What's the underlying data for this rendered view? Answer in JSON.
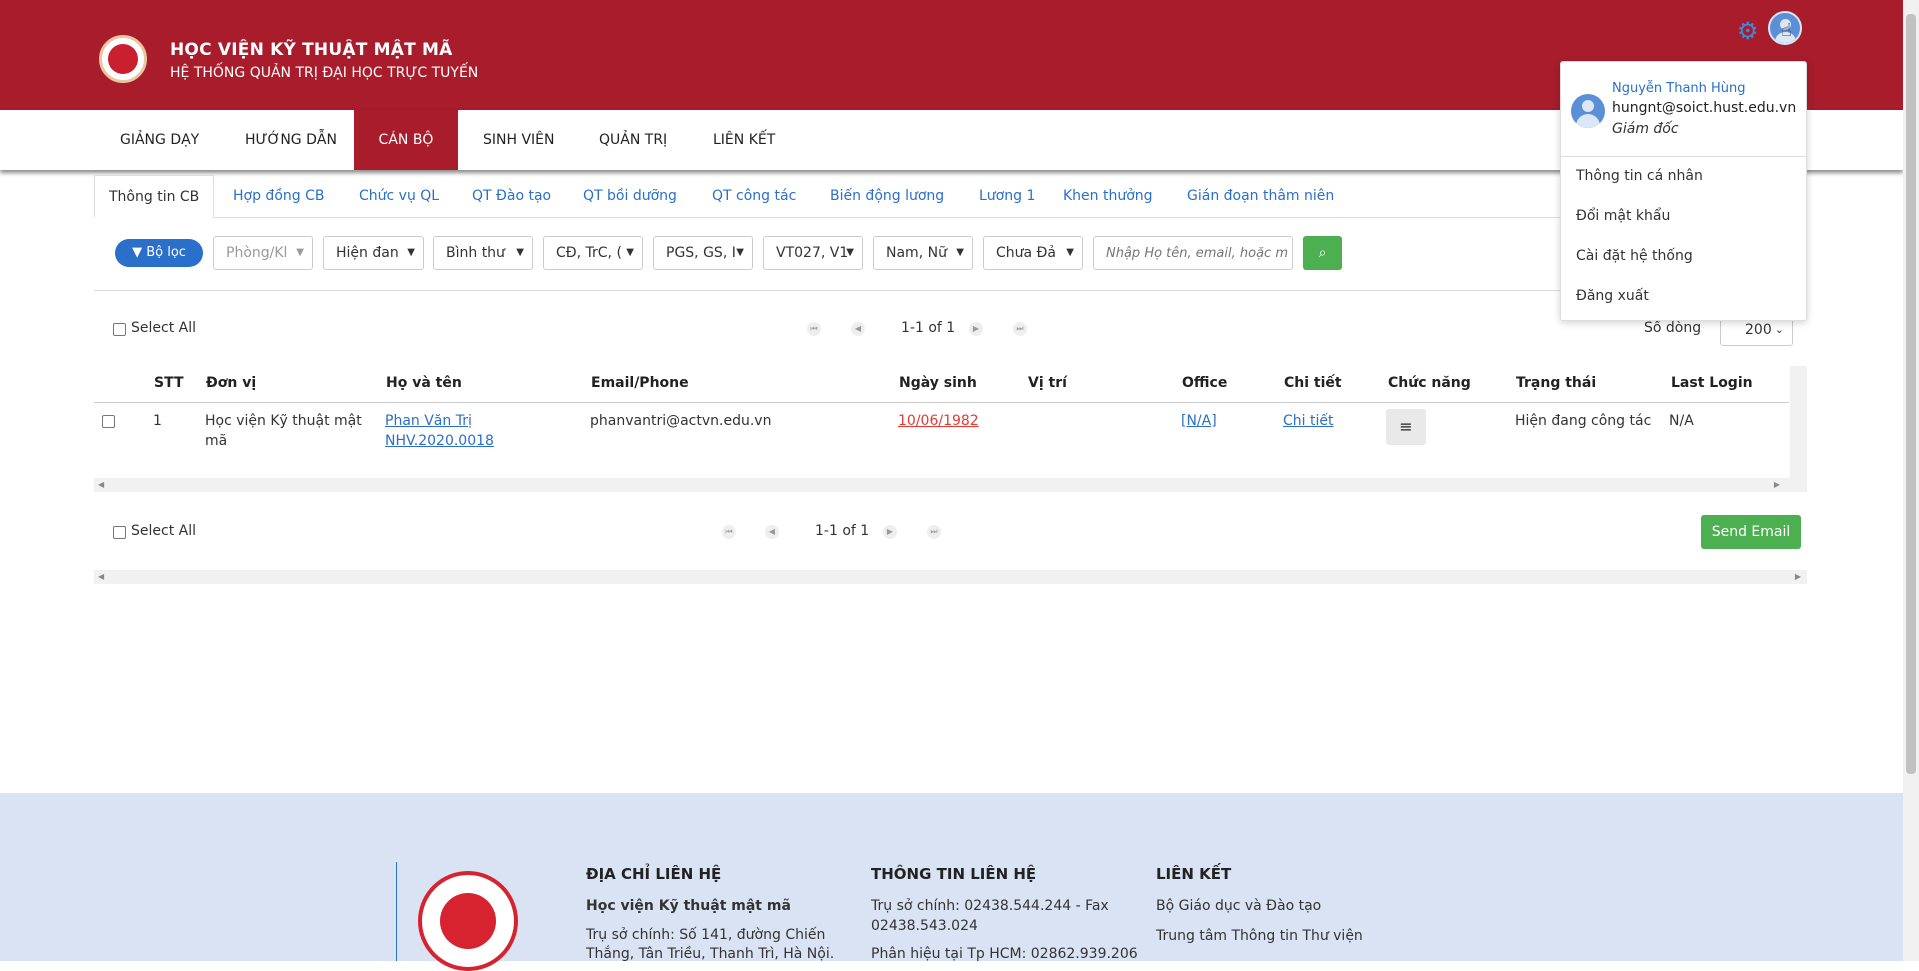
{
  "header": {
    "title": "HỌC VIỆN KỸ THUẬT MẬT MÃ",
    "subtitle": "HỆ THỐNG QUẢN TRỊ ĐẠI HỌC TRỰC TUYẾN",
    "settings_icon": "gear-icon",
    "avatar_icon": "user-avatar-icon",
    "colors": {
      "brand": "#a81c2c",
      "accent": "#2a6fc9",
      "success": "#4caf50"
    }
  },
  "nav": {
    "items": [
      {
        "label": "GIẢNG DẠY"
      },
      {
        "label": "HƯỚNG DẪN"
      },
      {
        "label": "CÁN BỘ",
        "active": true
      },
      {
        "label": "SINH VIÊN"
      },
      {
        "label": "QUẢN TRỊ"
      },
      {
        "label": "LIÊN KẾT"
      }
    ]
  },
  "tabs": [
    {
      "label": "Thông tin CB",
      "active": true
    },
    {
      "label": "Hợp đồng CB"
    },
    {
      "label": "Chức vụ QL"
    },
    {
      "label": "QT Đào tạo"
    },
    {
      "label": "QT bồi dưỡng"
    },
    {
      "label": "QT công tác"
    },
    {
      "label": "Biến động lương"
    },
    {
      "label": "Lương 1"
    },
    {
      "label": "Khen thưởng"
    },
    {
      "label": "Gián đoạn thâm niên"
    }
  ],
  "filters": {
    "filter_button": "Bộ lọc",
    "selects": [
      "Phòng/Kl",
      "Hiện đan",
      "Bình thư",
      "CĐ, TrC, (",
      "PGS, GS, I",
      "VT027, V1",
      "Nam, Nữ",
      "Chưa Đả"
    ],
    "search_placeholder": "Nhập Họ tên, email, hoặc m"
  },
  "pager_top": {
    "select_all": "Select All",
    "range": "1-1 of 1",
    "rows_label": "Số dòng",
    "rows_value": "200"
  },
  "table": {
    "headers": [
      "STT",
      "Đơn vị",
      "Họ và tên",
      "Email/Phone",
      "Ngày sinh",
      "Vị trí",
      "Office",
      "Chi tiết",
      "Chức năng",
      "Trạng thái",
      "Last Login"
    ],
    "rows": [
      {
        "stt": "1",
        "don_vi": "Học viện Kỹ thuật mật mã",
        "ho_ten": "Phan Văn Trị",
        "ma": "NHV.2020.0018",
        "email": "phanvantri@actvn.edu.vn",
        "ngay_sinh": "10/06/1982",
        "vi_tri": "",
        "office": "[N/A]",
        "chi_tiet": "Chi tiết",
        "trang_thai": "Hiện đang công tác",
        "last_login": "N/A"
      }
    ]
  },
  "pager_bottom": {
    "select_all": "Select All",
    "range": "1-1 of 1",
    "send_email": "Send Email"
  },
  "user_menu": {
    "name": "Nguyễn Thanh Hùng",
    "email": "hungnt@soict.hust.edu.vn",
    "role": "Giám đốc",
    "items": [
      "Thông tin cá nhân",
      "Đổi mật khẩu",
      "Cài đặt hệ thống",
      "Đăng xuất"
    ]
  },
  "footer": {
    "col1": {
      "heading": "ĐỊA CHỈ LIÊN HỆ",
      "line1": "Học viện Kỹ thuật mật mã",
      "line2": "Trụ sở chính: Số 141, đường Chiến",
      "line3": "Thắng, Tân Triều, Thanh Trì, Hà Nội."
    },
    "col2": {
      "heading": "THÔNG TIN LIÊN HỆ",
      "line1": "Trụ sở chính: 02438.544.244 - Fax",
      "line2": "02438.543.024",
      "line3": "Phân hiệu tại Tp HCM: 02862.939.206"
    },
    "col3": {
      "heading": "LIÊN KẾT",
      "line1": "Bộ Giáo dục và Đào tạo",
      "line2": "Trung tâm Thông tin Thư viện"
    }
  }
}
